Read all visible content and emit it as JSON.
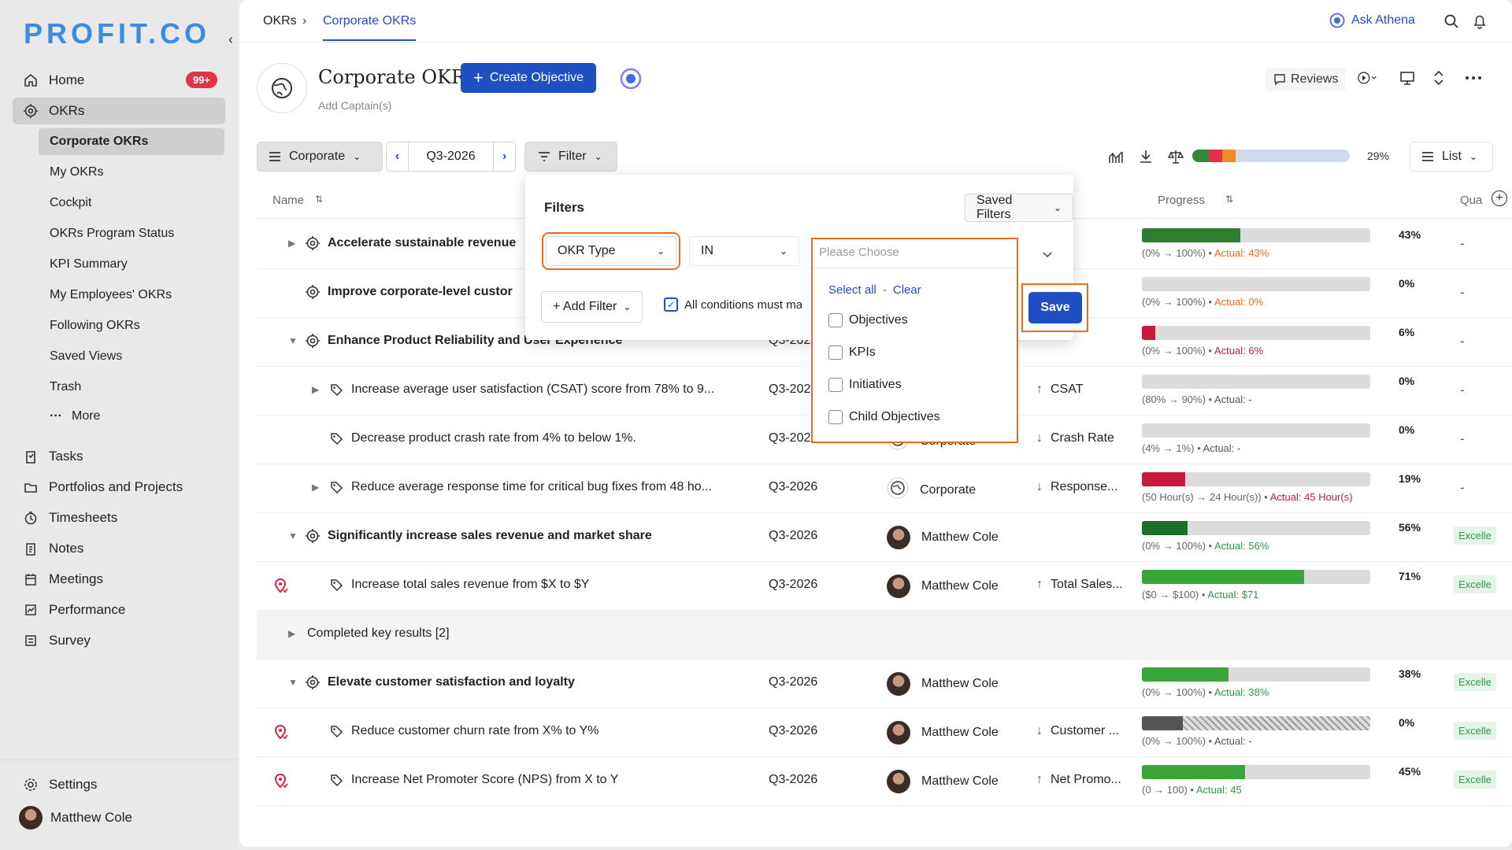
{
  "app": {
    "logo": "PROFIT.CO",
    "notif_count": "99+"
  },
  "sidebar": {
    "items": [
      {
        "label": "Home",
        "icon": "home-icon"
      },
      {
        "label": "OKRs",
        "icon": "target-icon"
      }
    ],
    "okr_sub": [
      "Corporate OKRs",
      "My OKRs",
      "Cockpit",
      "OKRs Program Status",
      "KPI Summary",
      "My Employees' OKRs",
      "Following OKRs",
      "Saved Views",
      "Trash"
    ],
    "more": "More",
    "lower": [
      {
        "label": "Tasks",
        "icon": "tasks-icon"
      },
      {
        "label": "Portfolios and Projects",
        "icon": "folder-icon"
      },
      {
        "label": "Timesheets",
        "icon": "timer-icon"
      },
      {
        "label": "Notes",
        "icon": "notes-icon"
      },
      {
        "label": "Meetings",
        "icon": "calendar-icon"
      },
      {
        "label": "Performance",
        "icon": "chart-icon"
      },
      {
        "label": "Survey",
        "icon": "survey-icon"
      }
    ],
    "settings": "Settings",
    "user": "Matthew Cole"
  },
  "topbar": {
    "crumb1": "OKRs",
    "crumb2": "Corporate OKRs",
    "ask": "Ask Athena"
  },
  "page": {
    "title": "Corporate OKRs",
    "captain": "Add Captain(s)",
    "create": "Create Objective",
    "reviews": "Reviews"
  },
  "toolbar": {
    "scope": "Corporate",
    "period": "Q3-2026",
    "filter": "Filter",
    "progress": "29%",
    "view": "List"
  },
  "status_segments": [
    {
      "color": "#2e8b3a",
      "pct": 0.105
    },
    {
      "color": "#e0344a",
      "pct": 0.085
    },
    {
      "color": "#f08a24",
      "pct": 0.085
    }
  ],
  "table": {
    "headers": {
      "name": "Name",
      "progress": "Progress",
      "quality": "Qua"
    },
    "rows": [
      {
        "name": "Accelerate sustainable revenue",
        "bold": true,
        "level": 0,
        "chev": "right",
        "type": "obj",
        "period": "",
        "owner": "",
        "metric": "",
        "dir": "",
        "fill": 0.43,
        "color": "#2e7d32",
        "pct": "43%",
        "rng": "(0% → 100%) •",
        "actual": "Actual: 43%",
        "actual_color": "#f06a1d",
        "qual": "-",
        "pin": false
      },
      {
        "name": "Improve corporate-level custor",
        "bold": true,
        "level": 0,
        "chev": "",
        "type": "obj",
        "period": "",
        "owner": "",
        "metric": "",
        "dir": "",
        "fill": 0,
        "color": "#2e7d32",
        "pct": "0%",
        "rng": "(0% → 100%) •",
        "actual": "Actual: 0%",
        "actual_color": "#f06a1d",
        "qual": "-",
        "pin": false
      },
      {
        "name": "Enhance Product Reliability and User Experience",
        "bold": true,
        "level": 0,
        "chev": "down",
        "type": "obj",
        "period": "Q3-2026",
        "owner": "",
        "metric": "",
        "dir": "",
        "fill": 0.06,
        "color": "#c8193c",
        "pct": "6%",
        "rng": "(0% → 100%) •",
        "actual": "Actual: 6%",
        "actual_color": "#c8193c",
        "qual": "-",
        "pin": false
      },
      {
        "name": "Increase average user satisfaction (CSAT) score from 78% to 9...",
        "bold": false,
        "level": 1,
        "chev": "right",
        "type": "kr",
        "period": "Q3-2026",
        "owner": "",
        "metric": "CSAT",
        "dir": "up",
        "fill": 0,
        "color": "#2e7d32",
        "pct": "0%",
        "rng": "(80% → 90%) •",
        "actual": "Actual: -",
        "actual_color": "#555",
        "qual": "-",
        "pin": false
      },
      {
        "name": "Decrease product crash rate from 4% to below 1%.",
        "bold": false,
        "level": 1,
        "chev": "",
        "type": "kr",
        "period": "Q3-2026",
        "owner": "Corporate",
        "owner_type": "org",
        "metric": "Crash Rate",
        "dir": "down",
        "fill": 0,
        "color": "#2e7d32",
        "pct": "0%",
        "rng": "(4% → 1%) •",
        "actual": "Actual: -",
        "actual_color": "#555",
        "qual": "-",
        "pin": false
      },
      {
        "name": "Reduce average response time for critical bug fixes from 48 ho...",
        "bold": false,
        "level": 1,
        "chev": "right",
        "type": "kr",
        "period": "Q3-2026",
        "owner": "Corporate",
        "owner_type": "org",
        "metric": "Response...",
        "dir": "down",
        "fill": 0.19,
        "color": "#c8193c",
        "pct": "19%",
        "rng": "(50 Hour(s) → 24 Hour(s)) •",
        "actual": "Actual: 45 Hour(s)",
        "actual_color": "#c8193c",
        "qual": "-",
        "pin": false
      },
      {
        "name": "Significantly increase sales revenue and market share",
        "bold": true,
        "level": 0,
        "chev": "down",
        "type": "obj",
        "period": "Q3-2026",
        "owner": "Matthew Cole",
        "owner_type": "user",
        "metric": "",
        "dir": "",
        "fill": 0.2,
        "color": "#1f6e2a",
        "pct": "56%",
        "rng": "(0% → 100%) •",
        "actual": "Actual: 56%",
        "actual_color": "#2e9a4a",
        "qual": "Excelle",
        "pin": false
      },
      {
        "name": "Increase total sales revenue from $X to $Y",
        "bold": false,
        "level": 1,
        "chev": "",
        "type": "kr",
        "period": "Q3-2026",
        "owner": "Matthew Cole",
        "owner_type": "user",
        "metric": "Total Sales...",
        "dir": "up",
        "fill": 0.71,
        "color": "#3aa63a",
        "pct": "71%",
        "rng": "($0 → $100) •",
        "actual": "Actual: $71",
        "actual_color": "#2e9a4a",
        "qual": "Excelle",
        "pin": true
      },
      {
        "name": "Completed key results [2]",
        "bold": false,
        "level": 0,
        "chev": "right",
        "type": "none",
        "grey": true,
        "period": "",
        "owner": "",
        "metric": "",
        "dir": "",
        "fill": -1,
        "pct": "",
        "rng": "",
        "actual": "",
        "qual": "",
        "pin": false
      },
      {
        "name": "Elevate customer satisfaction and loyalty",
        "bold": true,
        "level": 0,
        "chev": "down",
        "type": "obj",
        "period": "Q3-2026",
        "owner": "Matthew Cole",
        "owner_type": "user",
        "metric": "",
        "dir": "",
        "fill": 0.38,
        "color": "#3aa63a",
        "pct": "38%",
        "rng": "(0% → 100%) •",
        "actual": "Actual: 38%",
        "actual_color": "#2e9a4a",
        "qual": "Excelle",
        "pin": false
      },
      {
        "name": "Reduce customer churn rate from X% to Y%",
        "bold": false,
        "level": 1,
        "chev": "",
        "type": "kr",
        "period": "Q3-2026",
        "owner": "Matthew Cole",
        "owner_type": "user",
        "metric": "Customer ...",
        "dir": "down",
        "fill": 0.18,
        "color": "#555",
        "hatched": true,
        "pct": "0%",
        "rng": "(0% → 100%) •",
        "actual": "Actual: -",
        "actual_color": "#555",
        "qual": "Excelle",
        "pin": true
      },
      {
        "name": "Increase Net Promoter Score (NPS) from X to Y",
        "bold": false,
        "level": 1,
        "chev": "",
        "type": "kr",
        "period": "Q3-2026",
        "owner": "Matthew Cole",
        "owner_type": "user",
        "metric": "Net Promo...",
        "dir": "up",
        "fill": 0.45,
        "color": "#3aa63a",
        "pct": "45%",
        "rng": "(0 → 100) •",
        "actual": "Actual: 45",
        "actual_color": "#2e9a4a",
        "qual": "Excelle",
        "pin": true
      }
    ]
  },
  "filter": {
    "title": "Filters",
    "saved": "Saved Filters",
    "field": "OKR Type",
    "operator": "IN",
    "placeholder": "Please Choose",
    "add": "+ Add Filter",
    "all_conditions": "All conditions must ma",
    "save": "Save",
    "select_all": "Select all",
    "sep": "-",
    "clear": "Clear",
    "options": [
      "Objectives",
      "KPIs",
      "Initiatives",
      "Child Objectives"
    ]
  }
}
